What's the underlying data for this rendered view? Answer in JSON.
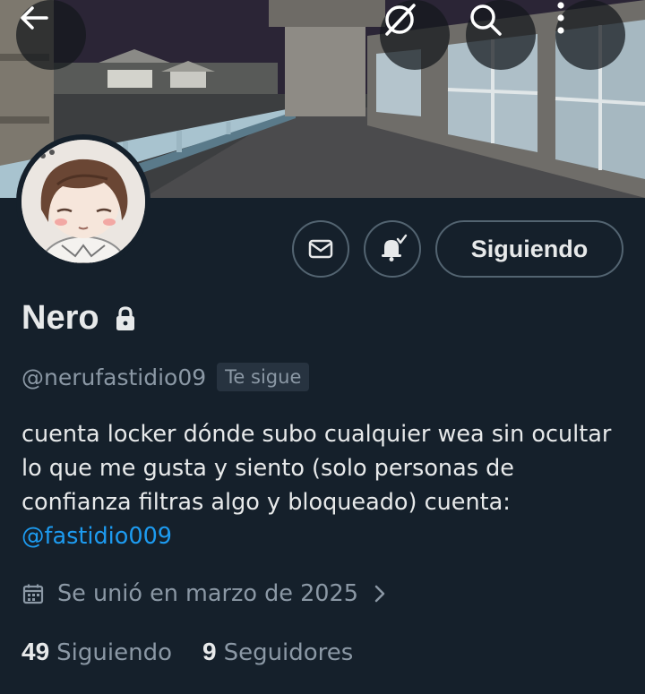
{
  "header": {
    "back_icon": "arrow-left-icon",
    "grok_icon": "grok-icon",
    "search_icon": "search-icon",
    "more_icon": "more-vertical-icon",
    "banner_alt": "game-balcony-night-banner"
  },
  "actions": {
    "message_icon": "envelope-icon",
    "notify_icon": "bell-check-icon",
    "following_label": "Siguiendo"
  },
  "profile": {
    "name": "Nero",
    "protected_icon": "lock-icon",
    "handle": "@nerufastidio09",
    "follows_you": "Te sigue",
    "bio_text": "cuenta locker dónde subo cualquier wea sin ocultar lo que me gusta y siento (solo personas de confianza filtras algo y bloqueado) cuenta: ",
    "bio_mention": "@fastidio009",
    "joined": "Se unió en marzo de 2025"
  },
  "stats": {
    "following_count": "49",
    "following_label": "Siguiendo",
    "followers_count": "9",
    "followers_label": "Seguidores"
  },
  "colors": {
    "background": "#15202b",
    "text": "#e7e9ea",
    "secondary": "#8b98a5",
    "accent": "#1d9bf0",
    "border": "#536471"
  }
}
